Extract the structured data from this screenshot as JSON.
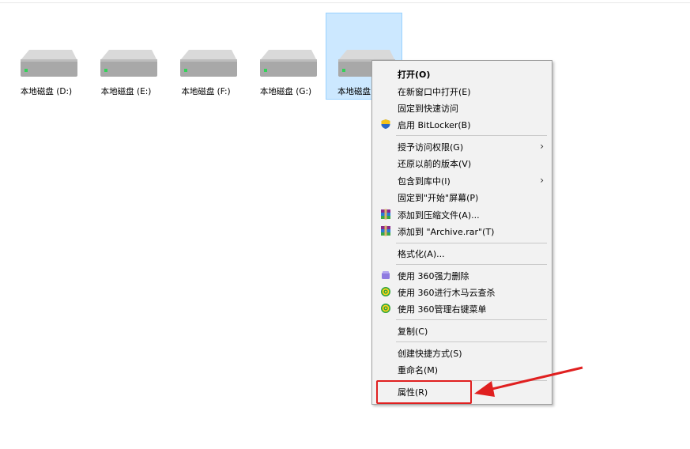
{
  "drives": [
    {
      "label": "本地磁盘 (D:)",
      "selected": false
    },
    {
      "label": "本地磁盘 (E:)",
      "selected": false
    },
    {
      "label": "本地磁盘 (F:)",
      "selected": false
    },
    {
      "label": "本地磁盘 (G:)",
      "selected": false
    },
    {
      "label": "本地磁盘",
      "selected": true
    }
  ],
  "context_menu": {
    "items": [
      {
        "label": "打开(O)",
        "bold": true
      },
      {
        "label": "在新窗口中打开(E)"
      },
      {
        "label": "固定到快速访问"
      },
      {
        "label": "启用 BitLocker(B)",
        "icon": "shield-icon"
      },
      {
        "label": "授予访问权限(G)",
        "submenu": true
      },
      {
        "label": "还原以前的版本(V)"
      },
      {
        "label": "包含到库中(I)",
        "submenu": true
      },
      {
        "label": "固定到\"开始\"屏幕(P)"
      },
      {
        "label": "添加到压缩文件(A)...",
        "icon": "winrar-icon"
      },
      {
        "label": "添加到 \"Archive.rar\"(T)",
        "icon": "winrar-icon"
      },
      {
        "label": "格式化(A)..."
      },
      {
        "label": "使用 360强力删除",
        "icon": "360-delete-icon"
      },
      {
        "label": "使用 360进行木马云查杀",
        "icon": "360-scan-icon"
      },
      {
        "label": "使用 360管理右键菜单",
        "icon": "360-manage-icon"
      },
      {
        "label": "复制(C)"
      },
      {
        "label": "创建快捷方式(S)"
      },
      {
        "label": "重命名(M)"
      },
      {
        "label": "属性(R)",
        "highlighted": true
      }
    ]
  },
  "colors": {
    "selection_bg": "#cce8ff",
    "menu_bg": "#f2f2f2",
    "annotation_red": "#e02020"
  }
}
